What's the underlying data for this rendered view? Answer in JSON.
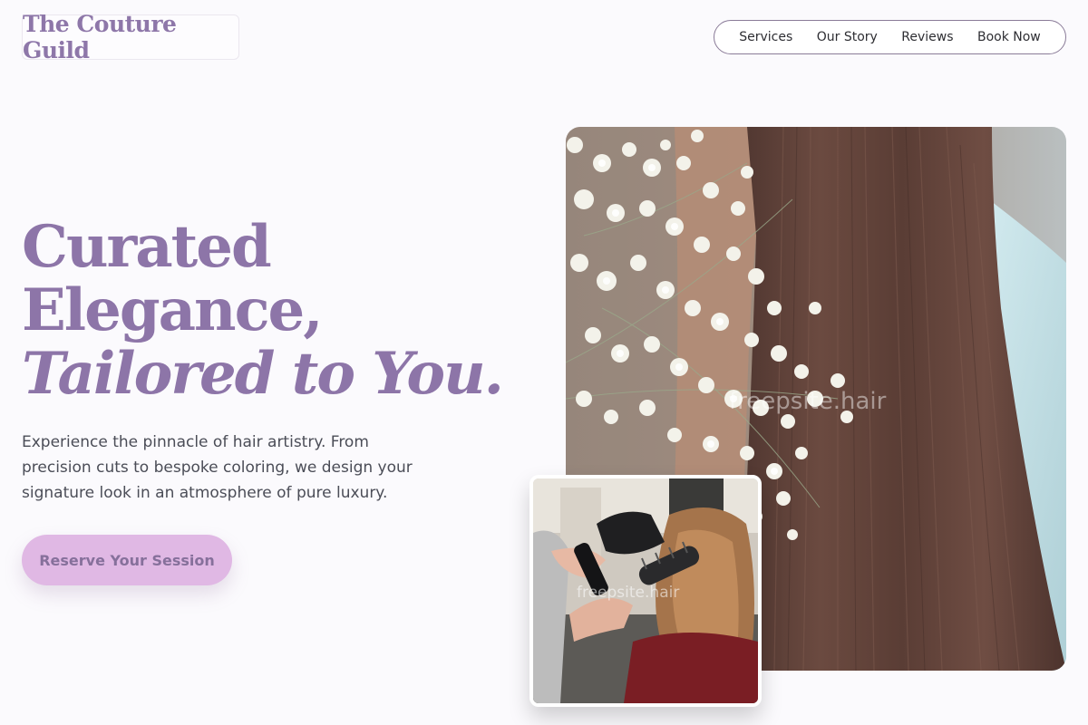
{
  "brand": {
    "name": "The Couture Guild"
  },
  "nav": {
    "items": [
      {
        "label": "Services"
      },
      {
        "label": "Our Story"
      },
      {
        "label": "Reviews"
      },
      {
        "label": "Book Now"
      }
    ]
  },
  "hero": {
    "headline_line1": "Curated",
    "headline_line2": "Elegance,",
    "headline_line3": "Tailored to You.",
    "description": "Experience the pinnacle of hair artistry. From precision cuts to bespoke coloring, we design your signature look in an atmosphere of pure luxury.",
    "cta_label": "Reserve Your Session"
  },
  "images": {
    "main": {
      "subject": "long straight brown hair with baby's breath flowers",
      "watermark": "freepsite.hair"
    },
    "inset": {
      "subject": "stylist blow-drying a client's hair with a round brush",
      "watermark": "freepsite.hair"
    }
  },
  "colors": {
    "accent": "#8d75a8",
    "cta_bg": "#e0b8e4",
    "page_bg": "#fbfafd"
  }
}
